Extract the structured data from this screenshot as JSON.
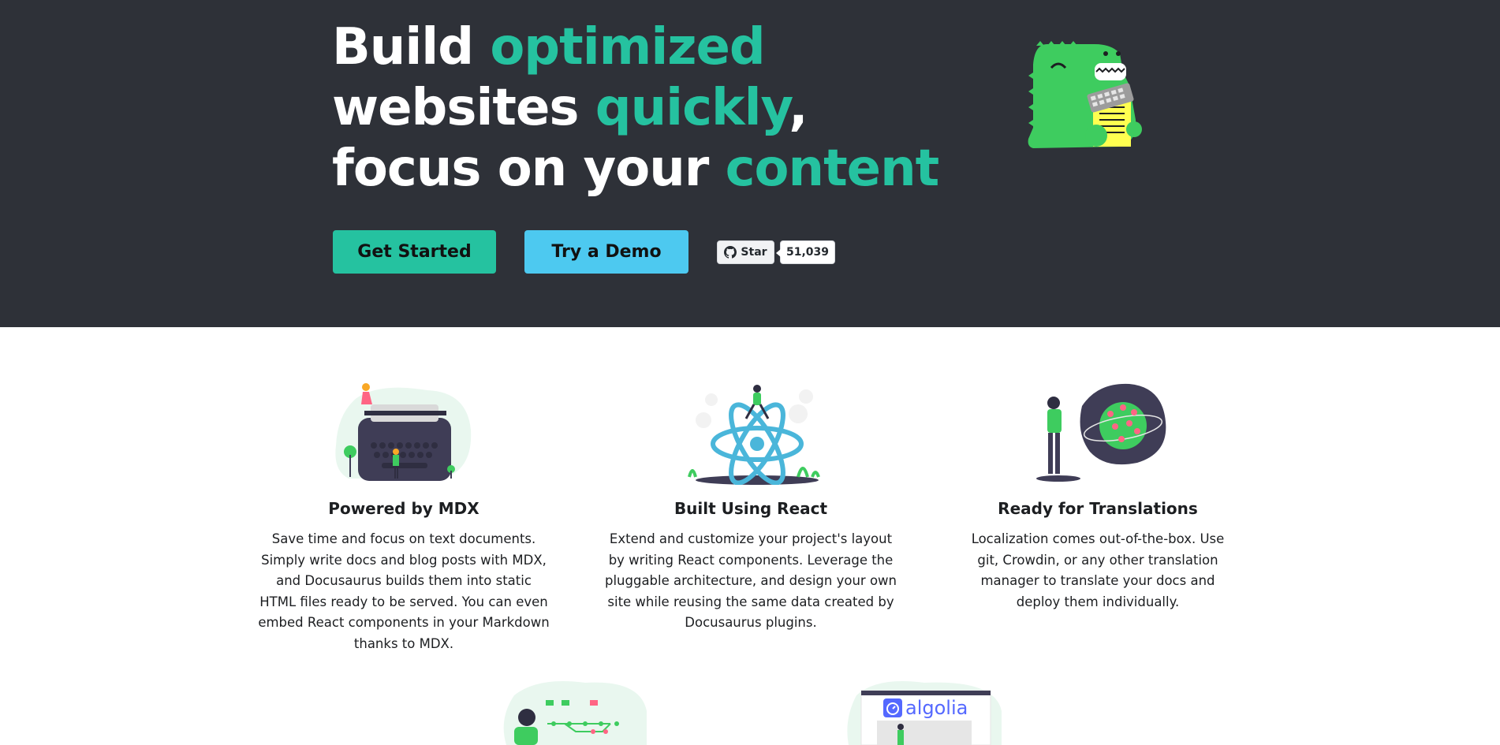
{
  "hero": {
    "title": {
      "part1": "Build ",
      "part2": "optimized",
      "part3": " websites ",
      "part4": "quickly",
      "part5": ", focus on your ",
      "part6": "content"
    },
    "get_started_label": "Get Started",
    "try_demo_label": "Try a Demo",
    "github": {
      "star_label": "Star",
      "star_count": "51,039"
    }
  },
  "features": [
    {
      "title": "Powered by MDX",
      "text": "Save time and focus on text documents. Simply write docs and blog posts with MDX, and Docusaurus builds them into static HTML files ready to be served. You can even embed React components in your Markdown thanks to MDX."
    },
    {
      "title": "Built Using React",
      "text": "Extend and customize your project's layout by writing React components. Leverage the pluggable architecture, and design your own site while reusing the same data created by Docusaurus plugins."
    },
    {
      "title": "Ready for Translations",
      "text": "Localization comes out-of-the-box. Use git, Crowdin, or any other translation manager to translate your docs and deploy them individually."
    }
  ],
  "bottom": {
    "algolia_label": "algolia"
  },
  "colors": {
    "hero_bg": "#2e3138",
    "accent": "#25c2a0",
    "demo_button": "#4dc9f0"
  }
}
